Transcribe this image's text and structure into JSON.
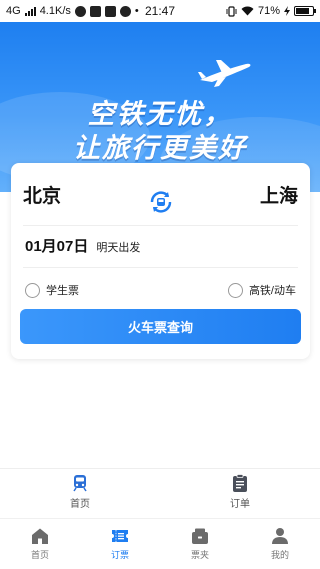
{
  "status_bar": {
    "network": "4G",
    "speed": "4.1K/s",
    "time": "21:47",
    "battery": "71%"
  },
  "hero": {
    "slogan_line1": "空铁无忧，",
    "slogan_line2": "让旅行更美好"
  },
  "booking": {
    "from_city": "北京",
    "to_city": "上海",
    "date": "01月07日",
    "date_hint": "明天出发",
    "option_student": "学生票",
    "option_highspeed": "高铁/动车",
    "search_button": "火车票查询"
  },
  "sub_nav": {
    "items": [
      {
        "label": "首页",
        "icon": "train-icon"
      },
      {
        "label": "订单",
        "icon": "clipboard-icon"
      }
    ]
  },
  "tab_bar": {
    "items": [
      {
        "label": "首页",
        "icon": "home-icon",
        "active": false
      },
      {
        "label": "订票",
        "icon": "ticket-icon",
        "active": true
      },
      {
        "label": "票夹",
        "icon": "wallet-icon",
        "active": false
      },
      {
        "label": "我的",
        "icon": "user-icon",
        "active": false
      }
    ]
  },
  "colors": {
    "accent": "#1f7ef1",
    "hero_top": "#1e7ff0",
    "hero_bottom": "#63b0fb",
    "inactive_icon": "#6b6b6b"
  }
}
